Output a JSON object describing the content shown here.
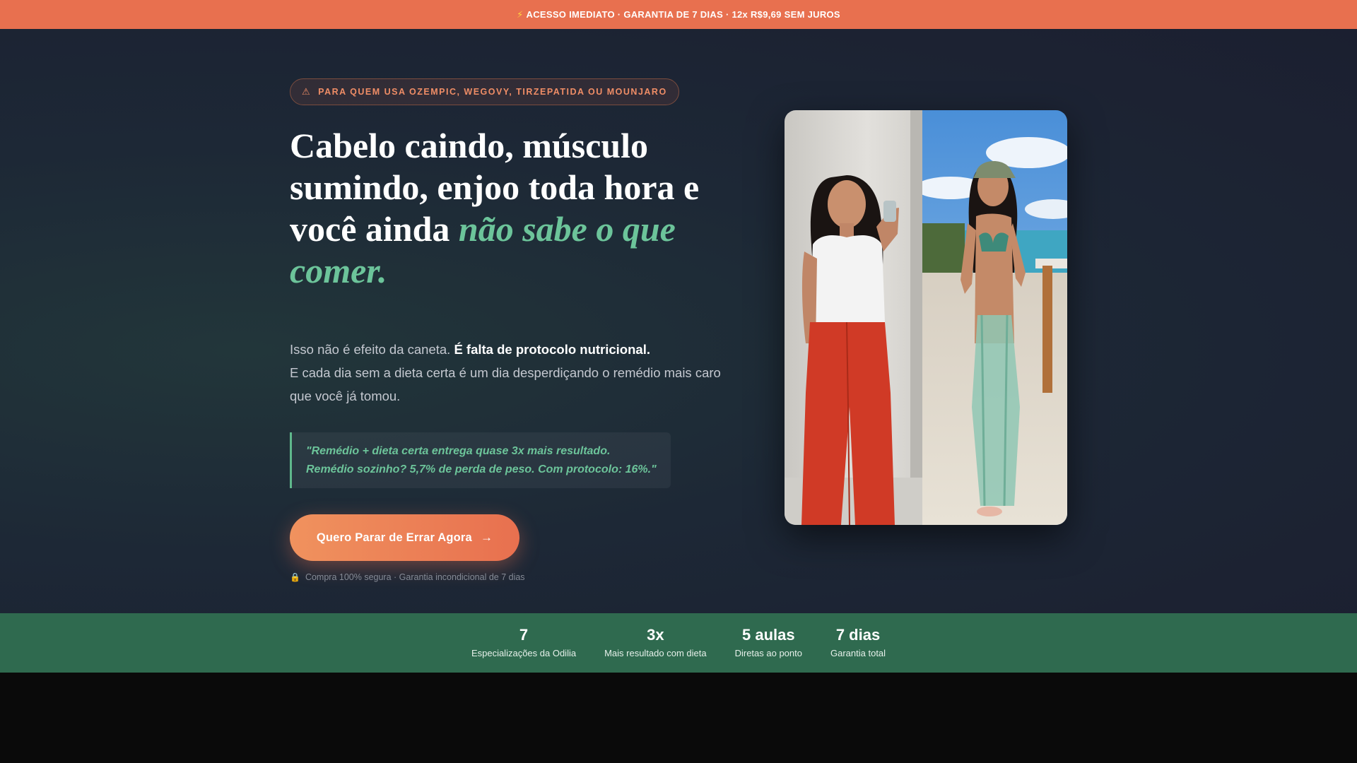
{
  "topbar": {
    "icon": "lightning-icon",
    "text": "ACESSO IMEDIATO · GARANTIA DE 7 DIAS · 12x R$9,69 SEM JUROS"
  },
  "hero": {
    "badge": {
      "icon": "warning-icon",
      "text": "PARA QUEM USA OZEMPIC, WEGOVY, TIRZEPATIDA OU MOUNJARO"
    },
    "headline": {
      "plain": "Cabelo caindo, músculo sumindo, enjoo toda hora e você ainda ",
      "accent": "não sabe o que comer."
    },
    "subtitle": {
      "lead": "Isso não é efeito da caneta. ",
      "bold": "É falta de protocolo nutricional.",
      "rest": "E cada dia sem a dieta certa é um dia desperdiçando o remédio mais caro que você já tomou."
    },
    "quote": {
      "line1": "\"Remédio + dieta certa entrega quase 3x mais resultado.",
      "line2": "Remédio sozinho? 5,7% de perda de peso. Com protocolo: 16%.\""
    },
    "cta": {
      "label": "Quero Parar de Errar Agora",
      "arrow": "→"
    },
    "secure": {
      "icon": "lock-icon",
      "text": "Compra 100% segura · Garantia incondicional de 7 dias"
    }
  },
  "stats": [
    {
      "value": "7",
      "label": "Especializações da Odilia"
    },
    {
      "value": "3x",
      "label": "Mais resultado com dieta"
    },
    {
      "value": "5 aulas",
      "label": "Diretas ao ponto"
    },
    {
      "value": "7 dias",
      "label": "Garantia total"
    }
  ],
  "colors": {
    "accent_orange": "#e8704f",
    "accent_green": "#6cc49a",
    "stats_green": "#2f6a4f"
  }
}
